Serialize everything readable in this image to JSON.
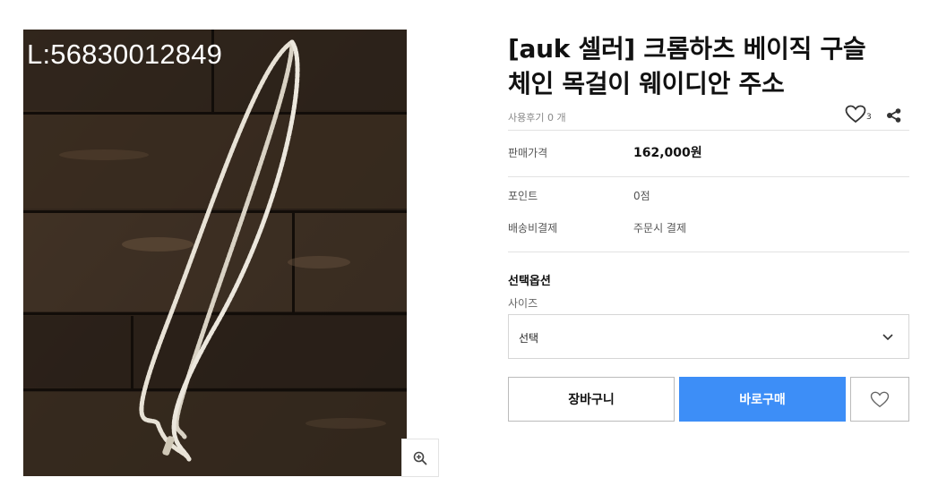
{
  "product": {
    "image_label": "L:56830012849",
    "title_line1": "[auk 셀러] 크롬하츠 베이직 구슬",
    "title_line2": "체인 목걸이 웨이디안 주소",
    "review_count_text": "사용후기 0 개",
    "like_count": "3",
    "price_label": "판매가격",
    "price_value": "162,000원",
    "points_label": "포인트",
    "points_value": "0점",
    "shipping_label": "배송비결제",
    "shipping_value": "주문시 결제"
  },
  "options": {
    "title": "선택옵션",
    "size_label": "사이즈",
    "size_selected": "선택"
  },
  "actions": {
    "cart_label": "장바구니",
    "buy_label": "바로구매"
  },
  "icons": {
    "zoom": "zoom-in-icon",
    "heart": "heart-icon",
    "share": "share-icon",
    "chevron": "chevron-down-icon"
  },
  "colors": {
    "buy_button": "#3d8ef7"
  }
}
